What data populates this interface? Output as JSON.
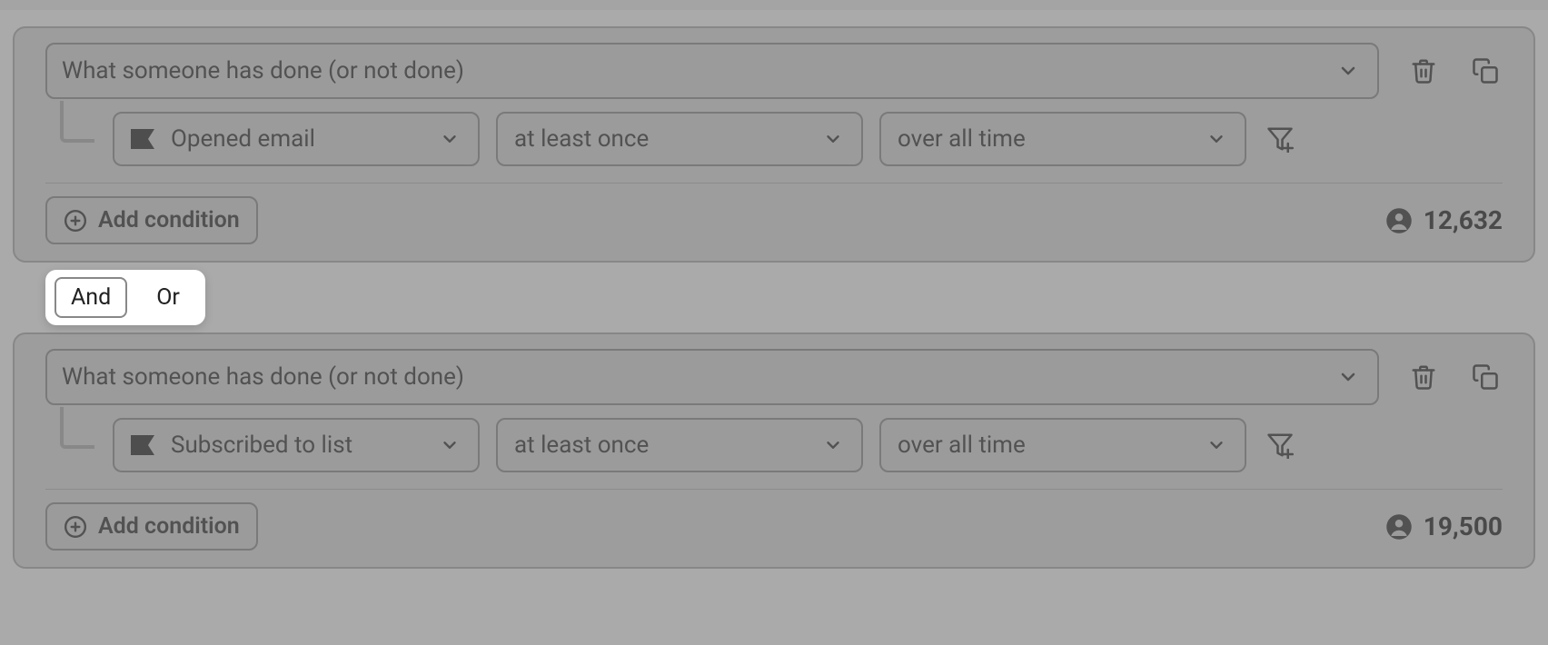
{
  "groups": [
    {
      "condition_type": "What someone has done (or not done)",
      "metric": "Opened email",
      "frequency": "at least once",
      "range": "over all time",
      "add_label": "Add condition",
      "count": "12,632"
    },
    {
      "condition_type": "What someone has done (or not done)",
      "metric": "Subscribed to list",
      "frequency": "at least once",
      "range": "over all time",
      "add_label": "Add condition",
      "count": "19,500"
    }
  ],
  "joiner": {
    "and": "And",
    "or": "Or"
  }
}
